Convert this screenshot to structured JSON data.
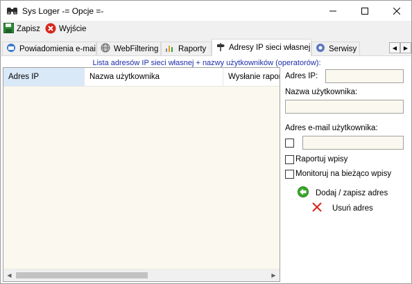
{
  "window": {
    "title": "Sys Loger -= Opcje =-",
    "controls": {
      "minimize": "—",
      "maximize": "☐",
      "close": "✕"
    }
  },
  "toolbar": {
    "save_label": "Zapisz",
    "exit_label": "Wyjście"
  },
  "tabs": [
    {
      "label": "Powiadomienia e-mail",
      "icon": "email-icon"
    },
    {
      "label": "WebFiltering",
      "icon": "globe-icon"
    },
    {
      "label": "Raporty",
      "icon": "chart-icon"
    },
    {
      "label": "Adresy IP sieci własnej",
      "icon": "signpost-icon",
      "active": true
    },
    {
      "label": "Serwisy",
      "icon": "services-icon"
    }
  ],
  "list": {
    "caption": "Lista adresów IP sieci własnej + nazwy użytkowników (operatorów):",
    "columns": [
      "Adres IP",
      "Nazwa użytkownika",
      "Wysłanie raport"
    ]
  },
  "form": {
    "ip_label": "Adres IP:",
    "ip_value": "",
    "username_label": "Nazwa użytkownika:",
    "username_value": "",
    "email_label": "Adres e-mail użytkownika:",
    "email_value": "",
    "report_label": "Raportuj wpisy",
    "monitor_label": "Monitoruj na bieżąco wpisy",
    "add_label": "Dodaj / zapisz adres",
    "delete_label": "Usuń adres"
  },
  "colors": {
    "accent_text": "#1c2ea8",
    "input_bg": "#fbf8ef",
    "selected_header": "#d9e9f7"
  }
}
